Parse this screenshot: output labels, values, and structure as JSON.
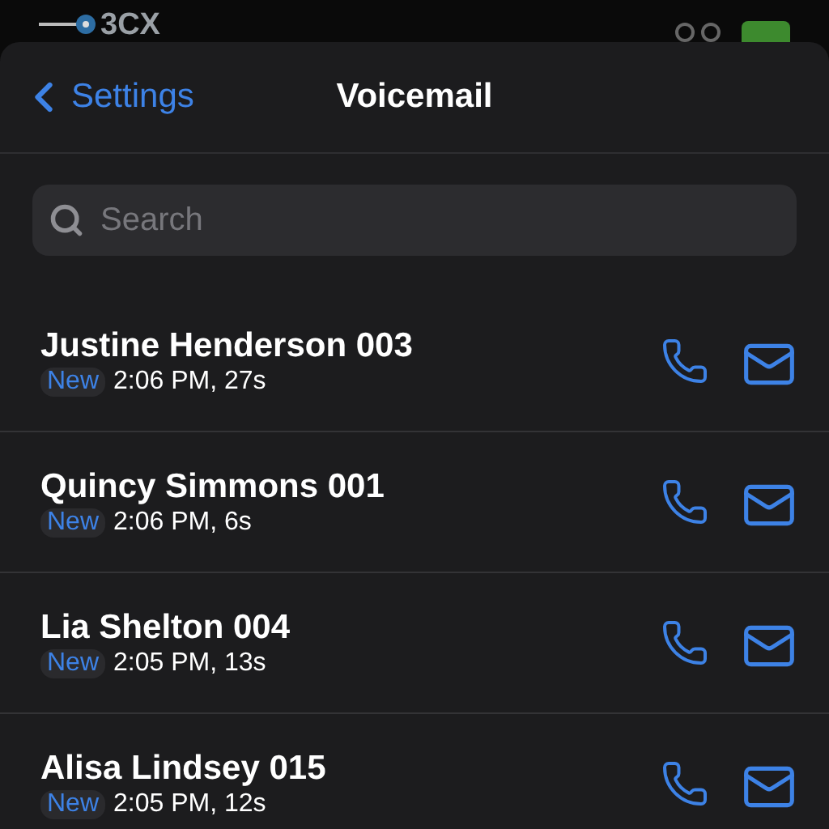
{
  "background_app": {
    "logo": "3CX"
  },
  "nav": {
    "back": "Settings",
    "title": "Voicemail"
  },
  "search": {
    "placeholder": "Search"
  },
  "voicemails": [
    {
      "name": "Justine Henderson 003",
      "new": true,
      "badge": "New",
      "meta": "2:06 PM, 27s"
    },
    {
      "name": "Quincy Simmons 001",
      "new": true,
      "badge": "New",
      "meta": "2:06 PM, 6s"
    },
    {
      "name": "Lia Shelton 004",
      "new": true,
      "badge": "New",
      "meta": "2:05 PM, 13s"
    },
    {
      "name": "Alisa Lindsey 015",
      "new": true,
      "badge": "New",
      "meta": "2:05 PM, 12s"
    }
  ]
}
